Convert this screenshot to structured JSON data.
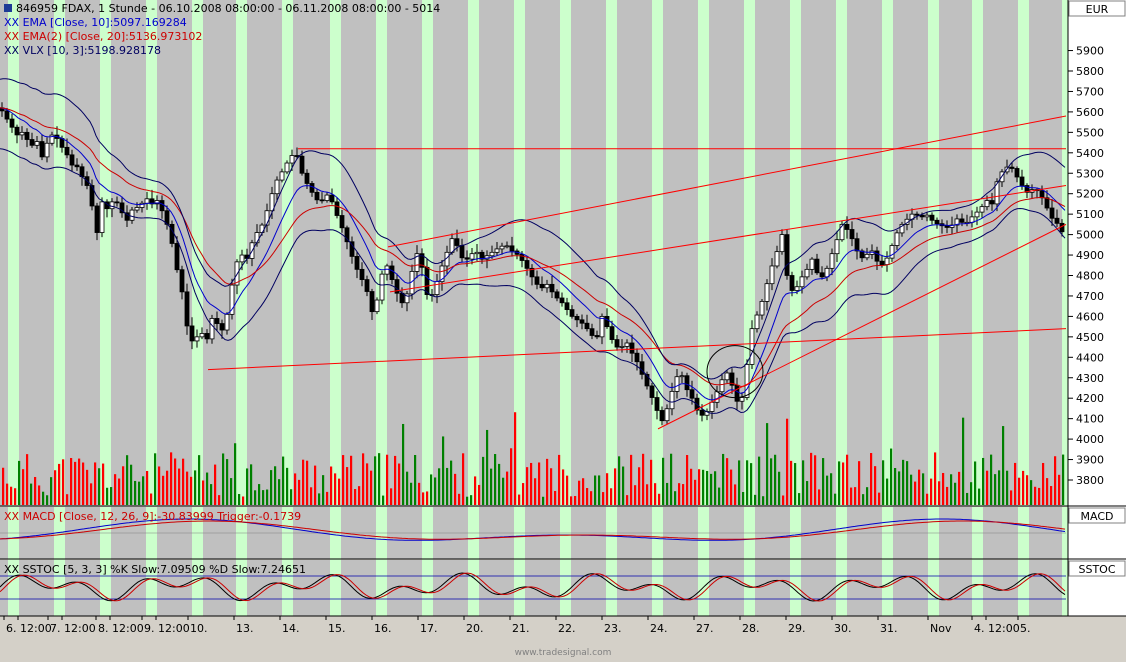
{
  "chart_data": {
    "type": "candlestick",
    "symbol_line": "846959  FDAX, 1 Stunde - 06.10.2008 08:00:00 - 06.11.2008 08:00:00 - 5014",
    "indicators": [
      {
        "label": "XX EMA [Close, 10]:5097.169284",
        "color": "#0000cc"
      },
      {
        "label": "XX EMA(2) [Close, 20]:5136.973102",
        "color": "#cc0000"
      },
      {
        "label": "XX VLX [10, 3]:5198.928178",
        "color": "#000060"
      }
    ],
    "currency": "EUR",
    "y_axis": {
      "min": 3700,
      "max": 6000,
      "ticks": [
        3800,
        3900,
        4000,
        4100,
        4200,
        4300,
        4400,
        4500,
        4600,
        4700,
        4800,
        4900,
        5000,
        5100,
        5200,
        5300,
        5400,
        5500,
        5600,
        5700,
        5800,
        5900
      ]
    },
    "x_ticks": [
      "6.",
      "12:00",
      "7.",
      "12:00",
      "8.",
      "12:00",
      "9.",
      "12:00",
      "10.",
      "13.",
      "14.",
      "15.",
      "16.",
      "17.",
      "20.",
      "21.",
      "22.",
      "23.",
      "24.",
      "27.",
      "28.",
      "29.",
      "30.",
      "31.",
      "Nov",
      "4.",
      "12:00",
      "5."
    ],
    "close_path": [
      [
        0,
        5620
      ],
      [
        4,
        5590
      ],
      [
        10,
        5540
      ],
      [
        18,
        5480
      ],
      [
        24,
        5510
      ],
      [
        30,
        5420
      ],
      [
        36,
        5470
      ],
      [
        42,
        5380
      ],
      [
        48,
        5460
      ],
      [
        54,
        5500
      ],
      [
        60,
        5440
      ],
      [
        66,
        5400
      ],
      [
        72,
        5340
      ],
      [
        78,
        5330
      ],
      [
        84,
        5260
      ],
      [
        90,
        5220
      ],
      [
        96,
        4980
      ],
      [
        102,
        5160
      ],
      [
        108,
        5120
      ],
      [
        114,
        5180
      ],
      [
        120,
        5130
      ],
      [
        126,
        5060
      ],
      [
        132,
        5120
      ],
      [
        140,
        5140
      ],
      [
        146,
        5180
      ],
      [
        152,
        5150
      ],
      [
        158,
        5170
      ],
      [
        164,
        5090
      ],
      [
        170,
        5010
      ],
      [
        176,
        4850
      ],
      [
        182,
        4720
      ],
      [
        188,
        4520
      ],
      [
        194,
        4460
      ],
      [
        200,
        4540
      ],
      [
        206,
        4470
      ],
      [
        212,
        4590
      ],
      [
        218,
        4560
      ],
      [
        224,
        4520
      ],
      [
        230,
        4700
      ],
      [
        236,
        4860
      ],
      [
        242,
        4900
      ],
      [
        248,
        4880
      ],
      [
        254,
        5000
      ],
      [
        260,
        5020
      ],
      [
        266,
        5100
      ],
      [
        272,
        5200
      ],
      [
        278,
        5280
      ],
      [
        284,
        5320
      ],
      [
        290,
        5380
      ],
      [
        296,
        5400
      ],
      [
        302,
        5300
      ],
      [
        308,
        5240
      ],
      [
        314,
        5190
      ],
      [
        320,
        5150
      ],
      [
        326,
        5200
      ],
      [
        332,
        5160
      ],
      [
        338,
        5080
      ],
      [
        344,
        5010
      ],
      [
        350,
        4920
      ],
      [
        356,
        4840
      ],
      [
        362,
        4780
      ],
      [
        368,
        4710
      ],
      [
        374,
        4580
      ],
      [
        380,
        4780
      ],
      [
        386,
        4860
      ],
      [
        392,
        4780
      ],
      [
        398,
        4700
      ],
      [
        404,
        4650
      ],
      [
        410,
        4770
      ],
      [
        416,
        4920
      ],
      [
        422,
        4840
      ],
      [
        428,
        4680
      ],
      [
        434,
        4720
      ],
      [
        440,
        4820
      ],
      [
        446,
        4900
      ],
      [
        452,
        4980
      ],
      [
        458,
        4940
      ],
      [
        464,
        4860
      ],
      [
        470,
        4900
      ],
      [
        476,
        4920
      ],
      [
        482,
        4880
      ],
      [
        488,
        4900
      ],
      [
        494,
        4920
      ],
      [
        500,
        4940
      ],
      [
        506,
        4950
      ],
      [
        512,
        4920
      ],
      [
        518,
        4900
      ],
      [
        524,
        4860
      ],
      [
        530,
        4810
      ],
      [
        536,
        4760
      ],
      [
        542,
        4740
      ],
      [
        548,
        4760
      ],
      [
        554,
        4700
      ],
      [
        560,
        4680
      ],
      [
        566,
        4640
      ],
      [
        572,
        4600
      ],
      [
        578,
        4580
      ],
      [
        584,
        4560
      ],
      [
        590,
        4520
      ],
      [
        596,
        4480
      ],
      [
        602,
        4600
      ],
      [
        608,
        4540
      ],
      [
        614,
        4460
      ],
      [
        620,
        4440
      ],
      [
        626,
        4480
      ],
      [
        632,
        4420
      ],
      [
        638,
        4370
      ],
      [
        644,
        4290
      ],
      [
        650,
        4230
      ],
      [
        656,
        4150
      ],
      [
        662,
        4090
      ],
      [
        668,
        4160
      ],
      [
        674,
        4270
      ],
      [
        680,
        4340
      ],
      [
        686,
        4250
      ],
      [
        692,
        4200
      ],
      [
        698,
        4130
      ],
      [
        704,
        4110
      ],
      [
        710,
        4160
      ],
      [
        716,
        4220
      ],
      [
        722,
        4290
      ],
      [
        728,
        4330
      ],
      [
        734,
        4230
      ],
      [
        740,
        4140
      ],
      [
        746,
        4330
      ],
      [
        752,
        4540
      ],
      [
        758,
        4620
      ],
      [
        764,
        4700
      ],
      [
        770,
        4820
      ],
      [
        776,
        4900
      ],
      [
        782,
        5000
      ],
      [
        788,
        4760
      ],
      [
        794,
        4710
      ],
      [
        800,
        4780
      ],
      [
        806,
        4820
      ],
      [
        812,
        4880
      ],
      [
        818,
        4800
      ],
      [
        824,
        4790
      ],
      [
        830,
        4880
      ],
      [
        836,
        4960
      ],
      [
        842,
        5050
      ],
      [
        848,
        5020
      ],
      [
        854,
        4960
      ],
      [
        860,
        4880
      ],
      [
        866,
        4900
      ],
      [
        872,
        4920
      ],
      [
        878,
        4860
      ],
      [
        884,
        4850
      ],
      [
        890,
        4920
      ],
      [
        896,
        5000
      ],
      [
        902,
        5050
      ],
      [
        908,
        5080
      ],
      [
        914,
        5110
      ],
      [
        920,
        5080
      ],
      [
        926,
        5100
      ],
      [
        932,
        5070
      ],
      [
        938,
        5050
      ],
      [
        944,
        5040
      ],
      [
        950,
        5030
      ],
      [
        956,
        5080
      ],
      [
        962,
        5060
      ],
      [
        968,
        5060
      ],
      [
        974,
        5100
      ],
      [
        980,
        5120
      ],
      [
        986,
        5170
      ],
      [
        992,
        5150
      ],
      [
        998,
        5280
      ],
      [
        1004,
        5320
      ],
      [
        1010,
        5340
      ],
      [
        1016,
        5290
      ],
      [
        1022,
        5240
      ],
      [
        1028,
        5200
      ],
      [
        1034,
        5230
      ],
      [
        1040,
        5200
      ],
      [
        1046,
        5140
      ],
      [
        1052,
        5080
      ],
      [
        1058,
        5050
      ],
      [
        1062,
        5014
      ]
    ],
    "horizontal_level": 5420,
    "macd": {
      "label": "XX MACD [Close, 12, 26, 9]:-30.83999  Trigger:-0.1739",
      "tag": "MACD"
    },
    "sstoc": {
      "label": "XX SSTOC [5, 3, 3]  %K Slow:7.09509  %D Slow:7.24651",
      "tag": "SSTOC"
    },
    "watermark": "www.tradesignal.com"
  }
}
